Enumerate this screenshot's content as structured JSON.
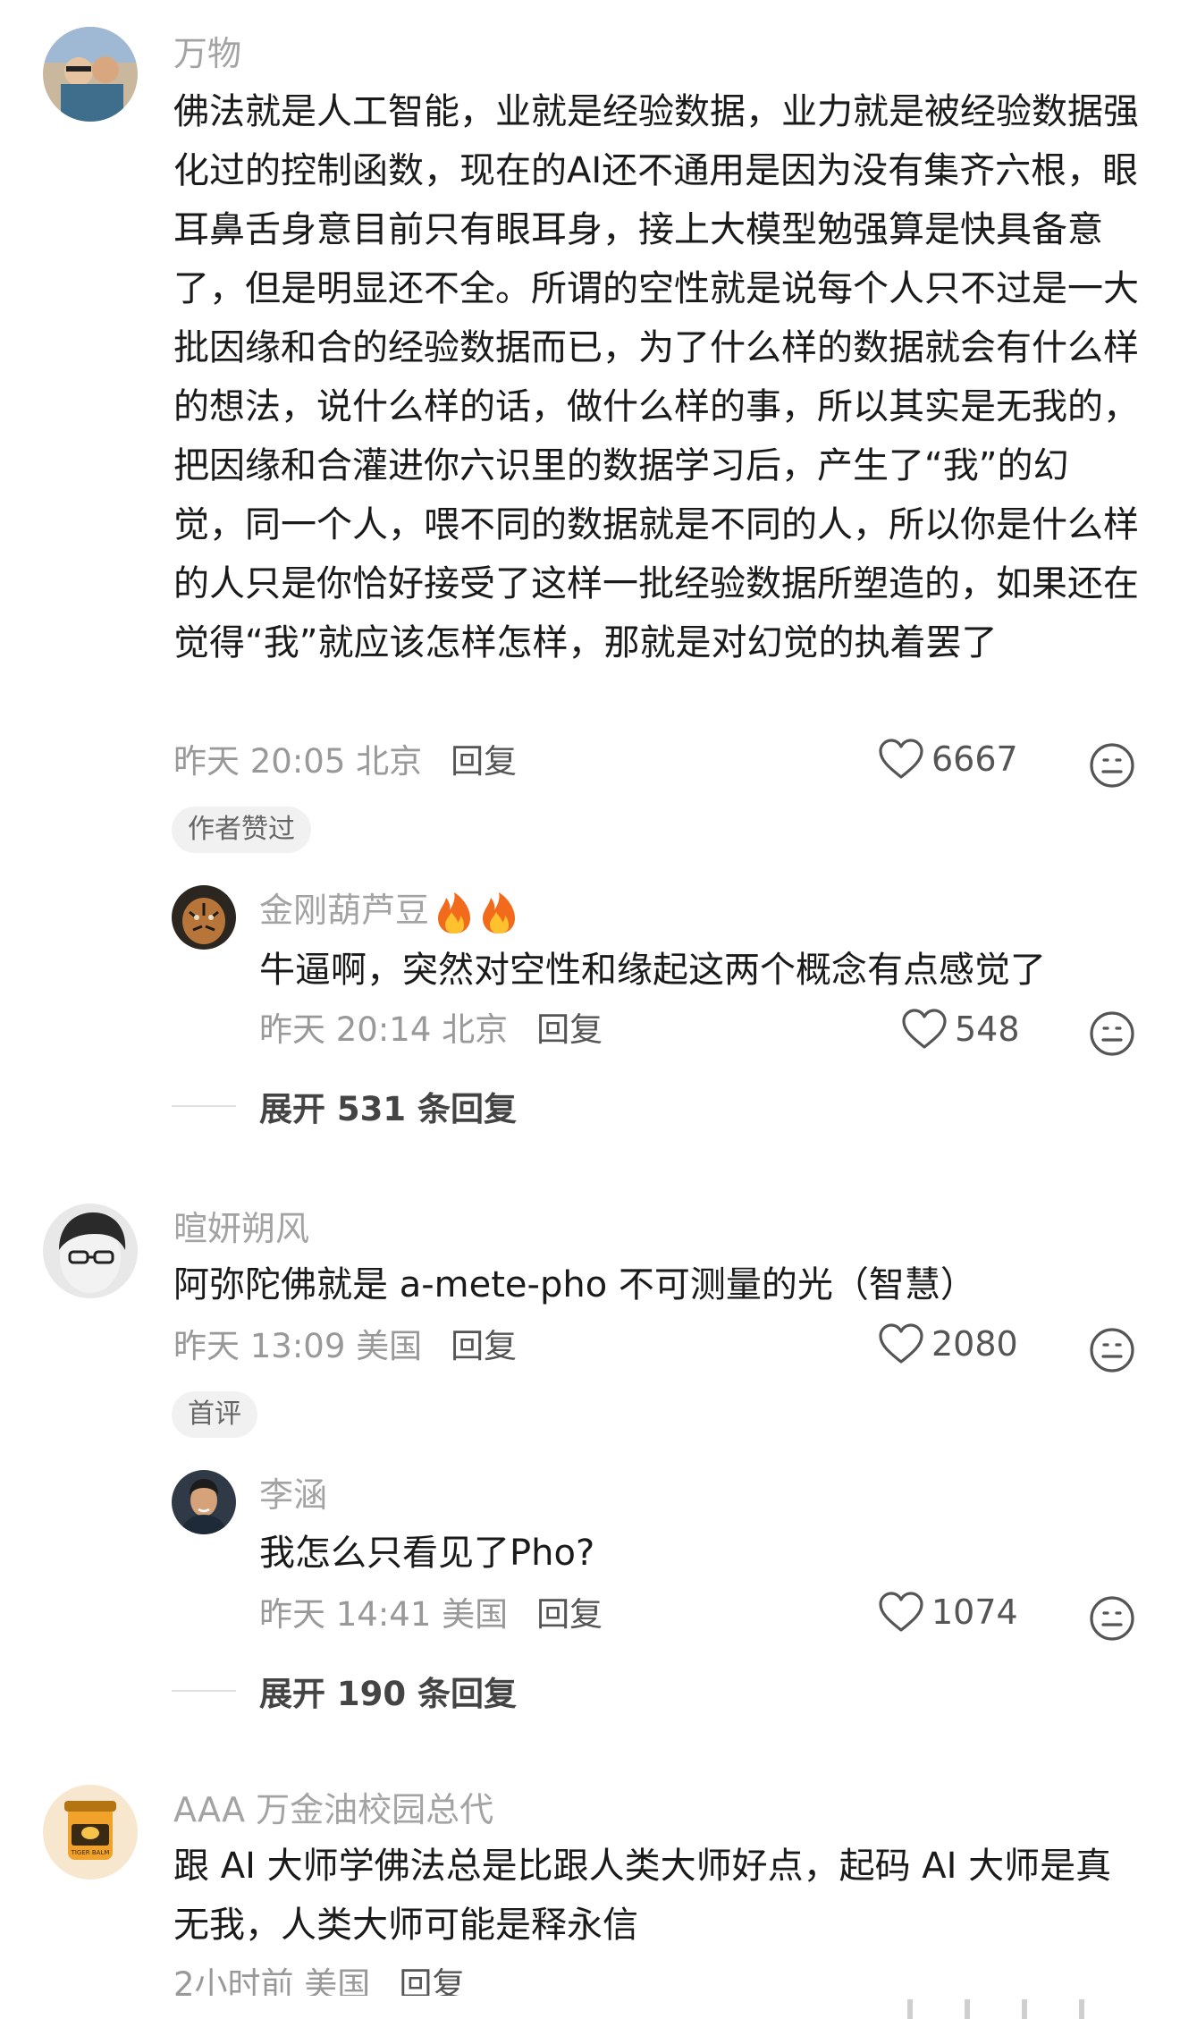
{
  "comments": [
    {
      "user": "万物",
      "text": "佛法就是人工智能，业就是经验数据，业力就是被经验数据强化过的控制函数，现在的AI还不通用是因为没有集齐六根，眼耳鼻舌身意目前只有眼耳身，接上大模型勉强算是快具备意了，但是明显还不全。所谓的空性就是说每个人只不过是一大批因缘和合的经验数据而已，为了什么样的数据就会有什么样的想法，说什么样的话，做什么样的事，所以其实是无我的，把因缘和合灌进你六识里的数据学习后，产生了“我”的幻觉，同一个人，喂不同的数据就是不同的人，所以你是什么样的人只是你恰好接受了这样一批经验数据所塑造的，如果还在觉得“我”就应该怎样怎样，那就是对幻觉的执着罢了",
      "time": "昨天 20:05 北京",
      "reply": "回复",
      "likes": "6667",
      "badge": "作者赞过",
      "sub_reply": {
        "user": "金刚葫芦豆",
        "text": "牛逼啊，突然对空性和缘起这两个概念有点感觉了",
        "time": "昨天 20:14 北京",
        "reply": "回复",
        "likes": "548"
      },
      "expand": "展开 531 条回复"
    },
    {
      "user": "暄妍朔风",
      "text": "阿弥陀佛就是 a-mete-pho 不可测量的光（智慧）",
      "time": "昨天 13:09 美国",
      "reply": "回复",
      "likes": "2080",
      "badge": "首评",
      "sub_reply": {
        "user": "李涵",
        "text": "我怎么只看见了Pho?",
        "time": "昨天 14:41 美国",
        "reply": "回复",
        "likes": "1074"
      },
      "expand": "展开 190 条回复"
    },
    {
      "user": "AAA 万金油校园总代",
      "text": "跟 AI 大师学佛法总是比跟人类大师好点，起码 AI 大师是真无我，人类大师可能是释永信",
      "time": "2小时前 美国",
      "reply": "回复",
      "avatar_label": "TIGER BALM"
    }
  ],
  "colors": {
    "text": "#1a1a1a",
    "muted": "#a3a3a3",
    "badge_bg": "#f1f1f1"
  },
  "icons": {
    "like": "heart-outline-icon",
    "reaction": "neutral-face-icon",
    "fire": "fire-emoji"
  }
}
